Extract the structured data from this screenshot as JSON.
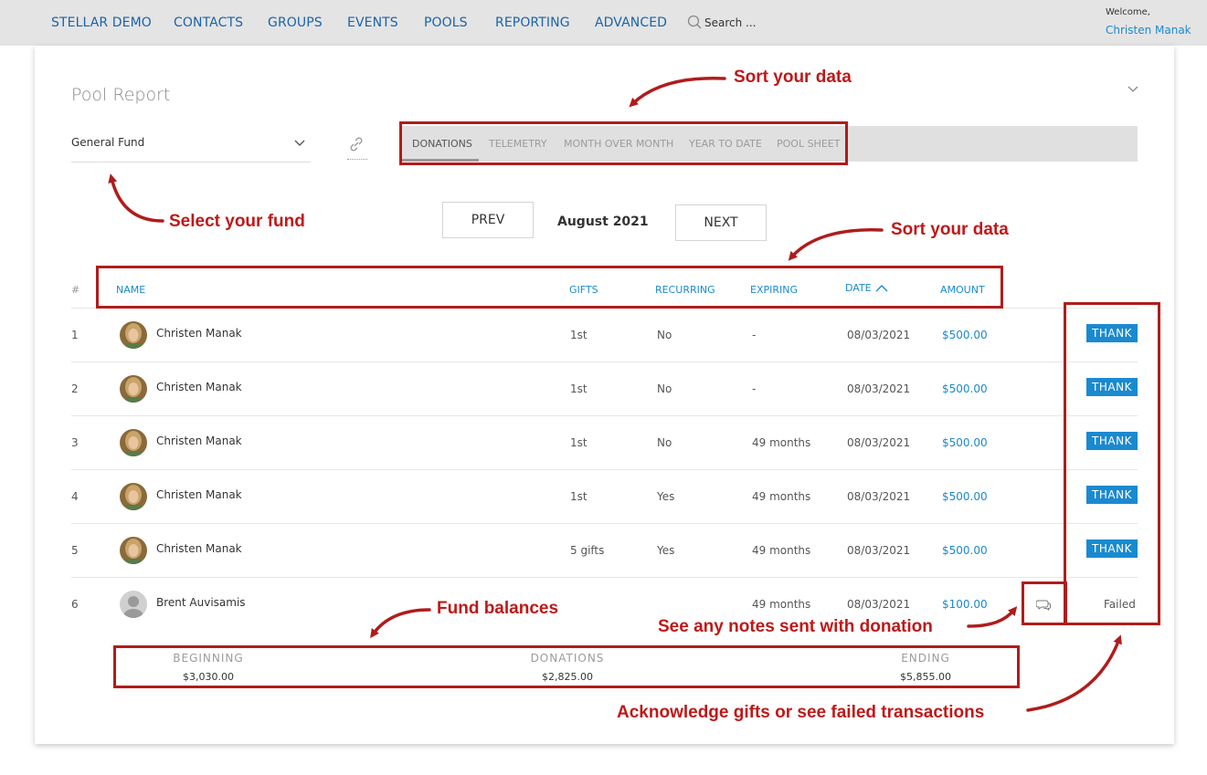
{
  "nav": {
    "items": [
      "STELLAR DEMO",
      "CONTACTS",
      "GROUPS",
      "EVENTS",
      "POOLS",
      "REPORTING",
      "ADVANCED"
    ],
    "search_placeholder": "Search ...",
    "welcome": "Welcome,",
    "user": "Christen Manak"
  },
  "report": {
    "title": "Pool Report",
    "fund": "General Fund",
    "tabs": [
      "DONATIONS",
      "TELEMETRY",
      "MONTH OVER MONTH",
      "YEAR TO DATE",
      "POOL SHEET"
    ],
    "active_tab": "DONATIONS",
    "prev_label": "PREV",
    "next_label": "NEXT",
    "month": "August 2021"
  },
  "table": {
    "headers": {
      "hash": "#",
      "name": "NAME",
      "gifts": "GIFTS",
      "recurring": "RECURRING",
      "expiring": "EXPIRING",
      "date": "DATE",
      "amount": "AMOUNT"
    },
    "sort_column": "DATE",
    "sort_direction": "ascending",
    "rows": [
      {
        "num": "1",
        "name": "Christen Manak",
        "gifts": "1st",
        "recurring": "No",
        "expiring": "-",
        "date": "08/03/2021",
        "amount": "$500.00",
        "action": "THANK"
      },
      {
        "num": "2",
        "name": "Christen Manak",
        "gifts": "1st",
        "recurring": "No",
        "expiring": "-",
        "date": "08/03/2021",
        "amount": "$500.00",
        "action": "THANK"
      },
      {
        "num": "3",
        "name": "Christen Manak",
        "gifts": "1st",
        "recurring": "No",
        "expiring": "49 months",
        "date": "08/03/2021",
        "amount": "$500.00",
        "action": "THANK"
      },
      {
        "num": "4",
        "name": "Christen Manak",
        "gifts": "1st",
        "recurring": "Yes",
        "expiring": "49 months",
        "date": "08/03/2021",
        "amount": "$500.00",
        "action": "THANK"
      },
      {
        "num": "5",
        "name": "Christen Manak",
        "gifts": "5 gifts",
        "recurring": "Yes",
        "expiring": "49 months",
        "date": "08/03/2021",
        "amount": "$500.00",
        "action": "THANK"
      },
      {
        "num": "6",
        "name": "Brent Auvisamis",
        "gifts": "",
        "recurring": "",
        "expiring": "49 months",
        "date": "08/03/2021",
        "amount": "$100.00",
        "action": "Failed"
      }
    ]
  },
  "balances": {
    "beginning_label": "BEGINNING",
    "beginning_value": "$3,030.00",
    "donations_label": "DONATIONS",
    "donations_value": "$2,825.00",
    "ending_label": "ENDING",
    "ending_value": "$5,855.00"
  },
  "annotations": {
    "sort_top": "Sort your data",
    "select_fund": "Select your fund",
    "sort_table": "Sort your data",
    "fund_balances": "Fund balances",
    "notes": "See any notes sent with donation",
    "acknowledge": "Acknowledge gifts or see failed transactions"
  },
  "colors": {
    "link": "#1a8ad0",
    "nav_link": "#1a64a8",
    "annotation_red": "#c01818",
    "topbar": "#e4e4e4"
  }
}
